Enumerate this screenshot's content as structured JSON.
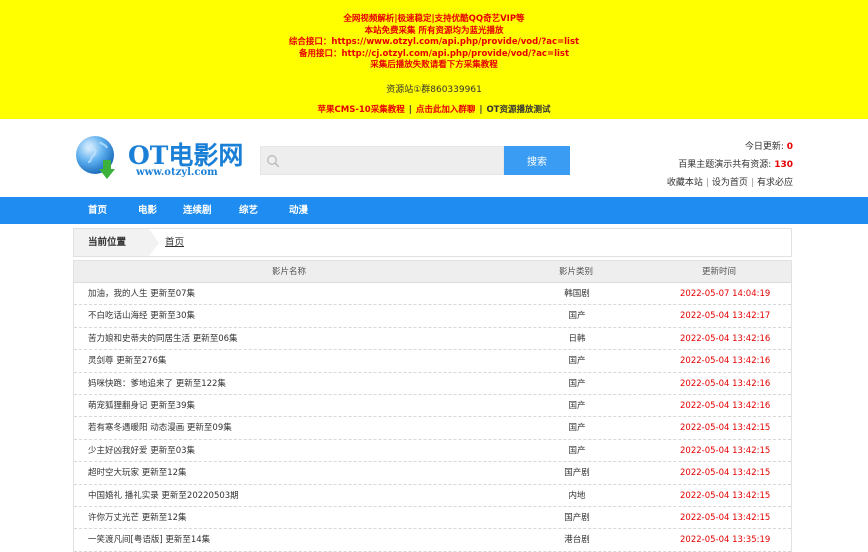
{
  "banner": {
    "line1": "全网视频解析|极速稳定|支持优酷QQ奇艺VIP等",
    "line2": "本站免费采集 所有资源均为蓝光播放",
    "line3": "综合接口：https://www.otzyl.com/api.php/provide/vod/?ac=list",
    "line4": "备用接口：http://cj.otzyl.com/api.php/provide/vod/?ac=list",
    "line5": "采集后播放失败请看下方采集教程",
    "qq": "资源站①群860339961",
    "link1": "苹果CMS-10采集教程",
    "link2": "点击此加入群聊",
    "link3": "OT资源播放测试"
  },
  "header": {
    "logo_title": "OT电影网",
    "logo_url": "www.otzyl.com",
    "search_placeholder": "",
    "search_button": "搜索",
    "today_label": "今日更新:",
    "today_value": "0",
    "total_label": "百果主题演示共有资源:",
    "total_value": "130",
    "link_bookmark": "收藏本站",
    "link_home": "设为首页",
    "link_ask": "有求必应",
    "colors": {
      "accent": "#1e8cf0",
      "banner": "#ffff00",
      "highlight": "#e60000"
    }
  },
  "nav": {
    "items": [
      {
        "label": "首页"
      },
      {
        "label": "电影"
      },
      {
        "label": "连续剧"
      },
      {
        "label": "综艺"
      },
      {
        "label": "动漫"
      }
    ]
  },
  "breadcrumb": {
    "current_label": "当前位置",
    "home": "首页"
  },
  "table": {
    "headers": {
      "title": "影片名称",
      "type": "影片类别",
      "time": "更新时间"
    },
    "rows": [
      {
        "title": "加油，我的人生 更新至07集",
        "type": "韩国剧",
        "time": "2022-05-07 14:04:19"
      },
      {
        "title": "不白吃话山海经 更新至30集",
        "type": "国产",
        "time": "2022-05-04 13:42:17"
      },
      {
        "title": "苦力娘和史蒂夫的同居生活 更新至06集",
        "type": "日韩",
        "time": "2022-05-04 13:42:16"
      },
      {
        "title": "灵剑尊 更新至276集",
        "type": "国产",
        "time": "2022-05-04 13:42:16"
      },
      {
        "title": "妈咪快跑：爹地追来了 更新至122集",
        "type": "国产",
        "time": "2022-05-04 13:42:16"
      },
      {
        "title": "萌宠狐狸翻身记 更新至39集",
        "type": "国产",
        "time": "2022-05-04 13:42:16"
      },
      {
        "title": "若有寒冬遇暖阳 动态漫画 更新至09集",
        "type": "国产",
        "time": "2022-05-04 13:42:15"
      },
      {
        "title": "少主好凶我好爱 更新至03集",
        "type": "国产",
        "time": "2022-05-04 13:42:15"
      },
      {
        "title": "超时空大玩家 更新至12集",
        "type": "国产剧",
        "time": "2022-05-04 13:42:15"
      },
      {
        "title": "中国婚礼 播礼实录 更新至20220503期",
        "type": "内地",
        "time": "2022-05-04 13:42:15"
      },
      {
        "title": "许你万丈光芒 更新至12集",
        "type": "国产剧",
        "time": "2022-05-04 13:42:15"
      },
      {
        "title": "一笑渡凡间[粤语版] 更新至14集",
        "type": "港台剧",
        "time": "2022-05-04 13:35:19"
      }
    ]
  }
}
